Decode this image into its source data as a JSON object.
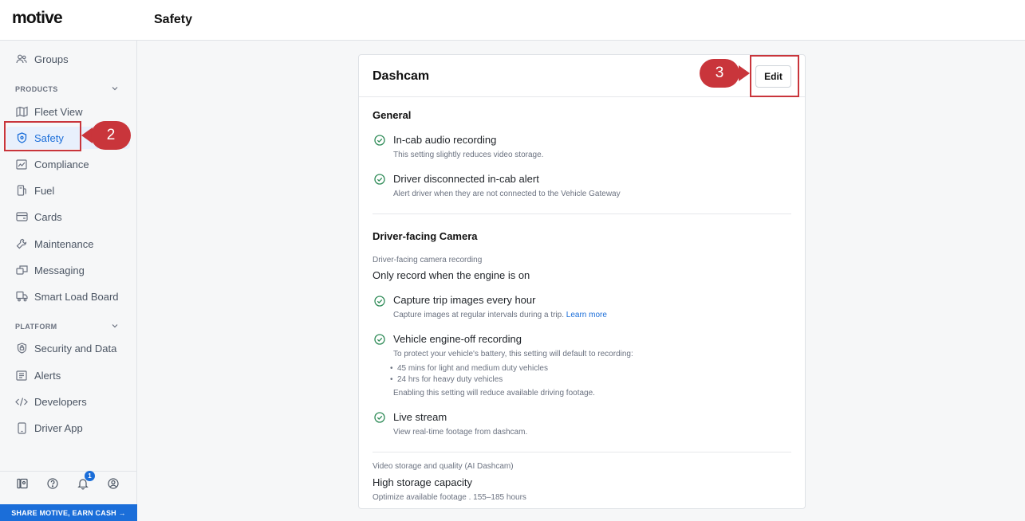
{
  "app": {
    "logo": "motive",
    "page_title": "Safety"
  },
  "sidebar": {
    "groups_label": "Groups",
    "products_label": "PRODUCTS",
    "platform_label": "PLATFORM",
    "products": [
      {
        "label": "Fleet View",
        "icon": "map-icon"
      },
      {
        "label": "Safety",
        "icon": "shield-icon",
        "active": true
      },
      {
        "label": "Compliance",
        "icon": "compliance-icon"
      },
      {
        "label": "Fuel",
        "icon": "fuel-icon"
      },
      {
        "label": "Cards",
        "icon": "card-icon"
      },
      {
        "label": "Maintenance",
        "icon": "wrench-icon"
      },
      {
        "label": "Messaging",
        "icon": "message-icon"
      },
      {
        "label": "Smart Load Board",
        "icon": "truck-icon"
      }
    ],
    "platform": [
      {
        "label": "Security and Data",
        "icon": "lock-shield-icon"
      },
      {
        "label": "Alerts",
        "icon": "alert-icon"
      },
      {
        "label": "Developers",
        "icon": "code-icon"
      },
      {
        "label": "Driver App",
        "icon": "phone-icon"
      }
    ],
    "notification_count": "1",
    "share_label": "SHARE MOTIVE, EARN CASH →"
  },
  "card": {
    "title": "Dashcam",
    "edit_label": "Edit",
    "general": {
      "title": "General",
      "items": [
        {
          "title": "In-cab audio recording",
          "desc": "This setting slightly reduces video storage."
        },
        {
          "title": "Driver disconnected in-cab alert",
          "desc": "Alert driver when they are not connected to the Vehicle Gateway"
        }
      ]
    },
    "driver_camera": {
      "title": "Driver-facing Camera",
      "recording_label": "Driver-facing camera recording",
      "recording_value": "Only record when the engine is on",
      "capture_title": "Capture trip images every hour",
      "capture_desc": "Capture images at regular intervals during a trip.",
      "learn_more": "Learn more",
      "engine_off_title": "Vehicle engine-off recording",
      "engine_off_desc": "To protect your vehicle's battery, this setting will default to recording:",
      "bullets": [
        "45 mins for light and medium duty vehicles",
        "24 hrs for heavy duty vehicles"
      ],
      "engine_off_note": "Enabling this setting will reduce available driving footage.",
      "live_title": "Live stream",
      "live_desc": "View real-time footage from dashcam."
    },
    "storage": {
      "label": "Video storage and quality (AI Dashcam)",
      "value": "High storage capacity",
      "desc": "Optimize available footage . 155–185 hours"
    }
  },
  "annotations": {
    "marker_2": "2",
    "marker_3": "3"
  },
  "colors": {
    "accent": "#1b6ed9",
    "check": "#2e8b57",
    "annotation": "#c9353b"
  }
}
